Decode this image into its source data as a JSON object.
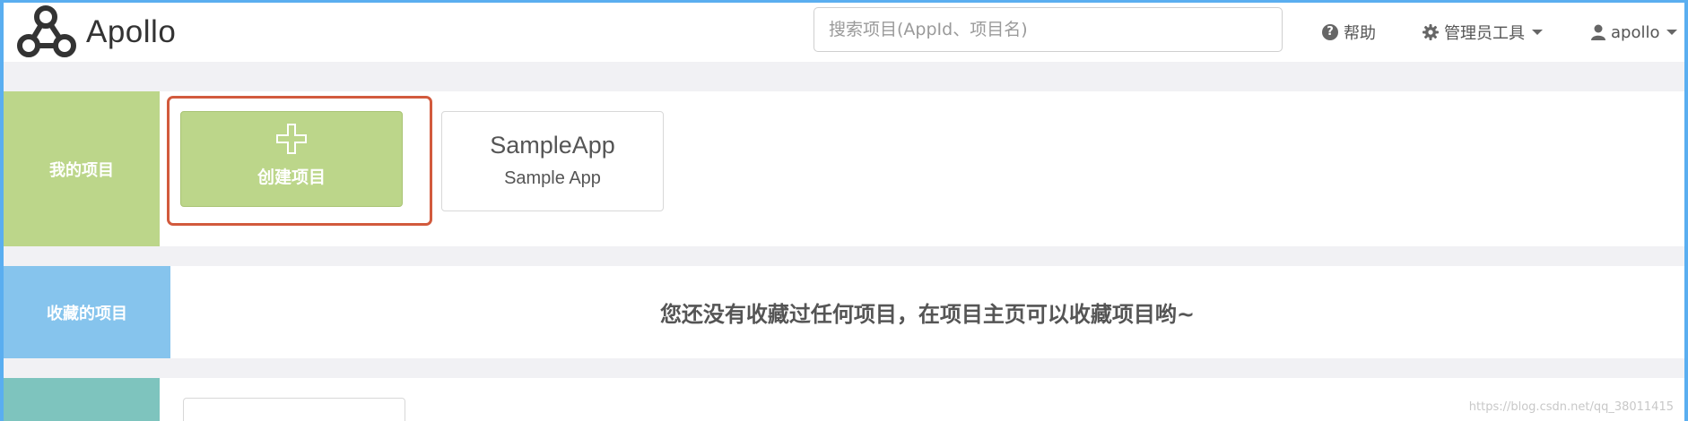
{
  "brand": {
    "name": "Apollo"
  },
  "search": {
    "placeholder": "搜索项目(AppId、项目名)"
  },
  "nav": {
    "help_label": "帮助",
    "admin_tools_label": "管理员工具",
    "user_label": "apollo"
  },
  "icons": {
    "help": "question-circle-icon",
    "admin": "gear-icon",
    "user": "user-icon",
    "create": "plus-icon"
  },
  "colors": {
    "my_projects": "#bcd68a",
    "favorites": "#86c4ed",
    "recent": "#7ec4be",
    "highlight_outline": "#d25a3d"
  },
  "sections": {
    "my_projects": {
      "label": "我的项目",
      "create_label": "创建项目",
      "apps": [
        {
          "app_id": "SampleApp",
          "name": "Sample App"
        }
      ]
    },
    "favorites": {
      "label": "收藏的项目",
      "empty_message": "您还没有收藏过任何项目，在项目主页可以收藏项目哟~"
    }
  },
  "watermark": "https://blog.csdn.net/qq_38011415"
}
